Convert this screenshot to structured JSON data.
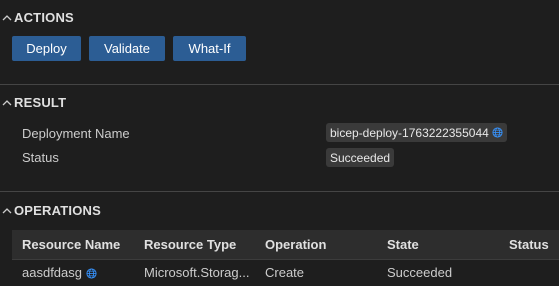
{
  "actions": {
    "title": "ACTIONS",
    "buttons": {
      "deploy": "Deploy",
      "validate": "Validate",
      "whatif": "What-If"
    }
  },
  "result": {
    "title": "RESULT",
    "deployment_name_label": "Deployment Name",
    "deployment_name_value": "bicep-deploy-1763222355044",
    "status_label": "Status",
    "status_value": "Succeeded"
  },
  "operations": {
    "title": "OPERATIONS",
    "columns": [
      "Resource Name",
      "Resource Type",
      "Operation",
      "State",
      "Status"
    ],
    "rows": [
      {
        "resource_name": "aasdfdasg",
        "resource_type": "Microsoft.Storag...",
        "operation": "Create",
        "state": "Succeeded",
        "status": ""
      }
    ]
  },
  "colors": {
    "button_bg": "#2c5d94",
    "background": "#1e1e1e",
    "link_icon": "#3794ff"
  },
  "icons": {
    "section_toggle": "chevron-up-icon",
    "portal_link": "globe-icon"
  }
}
